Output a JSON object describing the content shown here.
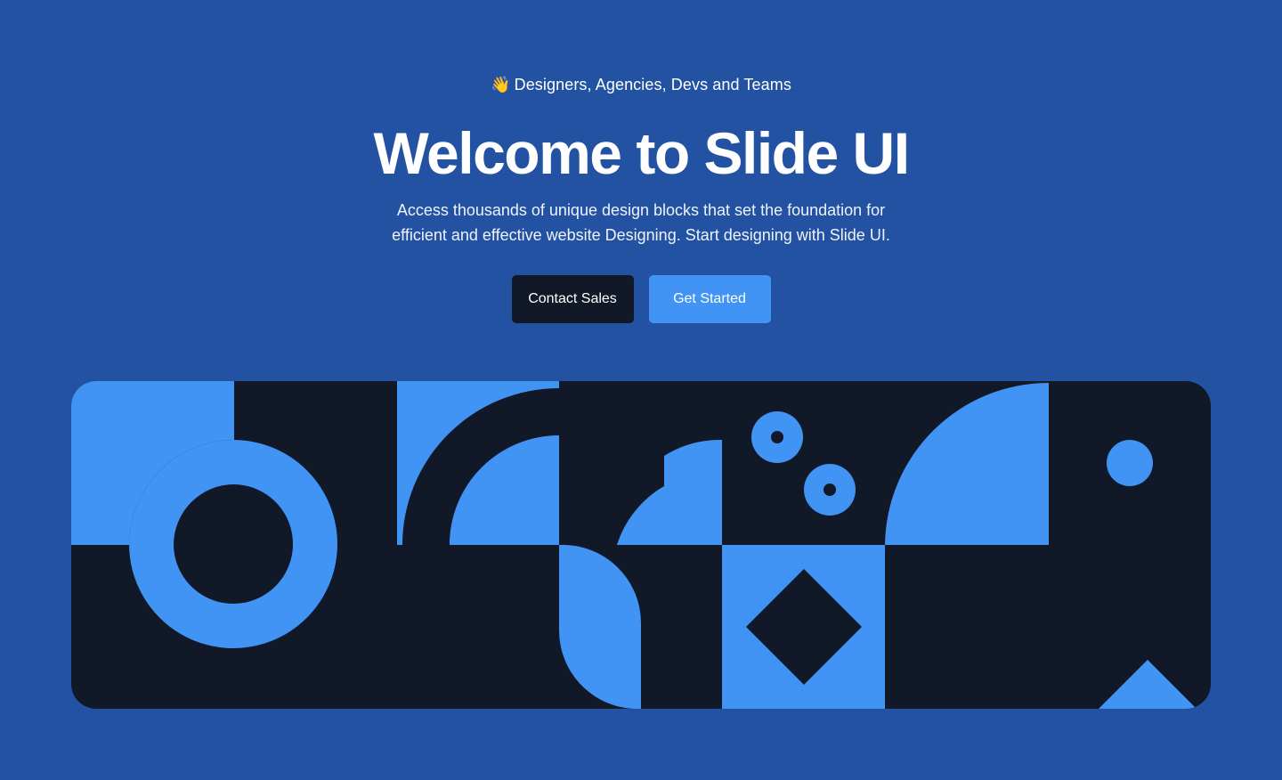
{
  "hero": {
    "tagline_icon": "waving-hand-icon",
    "tagline_emoji": "👋",
    "tagline": "Designers, Agencies, Devs and Teams",
    "title": "Welcome to Slide UI",
    "description_line1": "Access thousands of unique design blocks that set the foundation for",
    "description_line2": "efficient and effective website Designing. Start designing with Slide UI."
  },
  "actions": {
    "contact_label": "Contact Sales",
    "start_label": "Get Started"
  },
  "colors": {
    "background": "#2352a3",
    "dark": "#111827",
    "accent": "#4193f4"
  }
}
